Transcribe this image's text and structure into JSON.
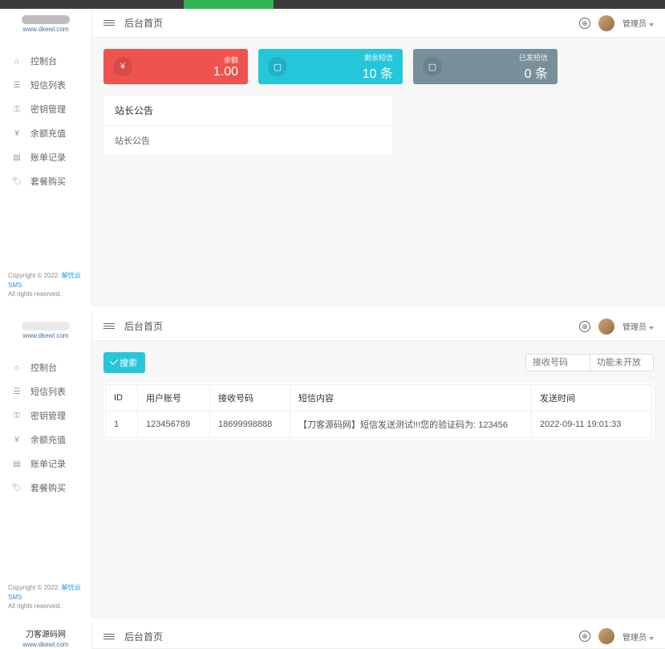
{
  "global": {
    "page_title": "后台首页",
    "user_name": "管理员",
    "logo_url": "www.dkewl.com",
    "logo_text": "刀客源码网"
  },
  "sidebar": {
    "items": [
      {
        "icon": "home",
        "label": "控制台"
      },
      {
        "icon": "list",
        "label": "短信列表"
      },
      {
        "icon": "key",
        "label": "密钥管理"
      },
      {
        "icon": "yen",
        "label": "余额充值"
      },
      {
        "icon": "record",
        "label": "账单记录"
      },
      {
        "icon": "tag",
        "label": "套餐购买"
      }
    ],
    "footer": {
      "copyright": "Copyright © 2022.",
      "link_text": "解忧云SMS",
      "rights": "All rights reserved."
    }
  },
  "dashboard": {
    "cards": [
      {
        "label": "余额",
        "value": "1.00",
        "icon": "¥"
      },
      {
        "label": "剩余短信",
        "value": "10 条",
        "icon": "▢"
      },
      {
        "label": "已发短信",
        "value": "0 条",
        "icon": "▢"
      }
    ],
    "announce": {
      "title": "站长公告",
      "body": "站长公告"
    }
  },
  "sms_list": {
    "search_btn": "搜索",
    "inputs": {
      "phone_placeholder": "接收号码",
      "func_placeholder": "功能未开放"
    },
    "columns": [
      "ID",
      "用户账号",
      "接收号码",
      "短信内容",
      "发送时间"
    ],
    "rows": [
      {
        "id": "1",
        "user": "123456789",
        "phone": "18699998888",
        "content": "【刀客源码网】短信发送测试!!!您的验证码为: 123456",
        "time": "2022-09-11 19:01:33"
      }
    ]
  }
}
